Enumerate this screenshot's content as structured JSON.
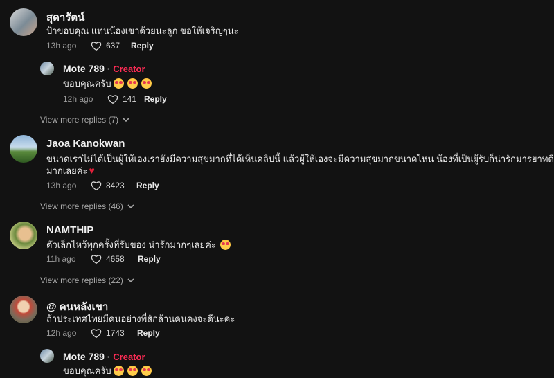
{
  "comments": [
    {
      "username": "สุดารัตน์",
      "text": "ป้าขอบคุณ แทนน้องเขาด้วยนะลูก ขอให้เจริญๆนะ",
      "time": "13h ago",
      "likes": "637",
      "reply_label": "Reply",
      "reply": {
        "username": "Mote 789",
        "separator": "·",
        "badge": "Creator",
        "text": "ขอบคุณครับ",
        "emojis": [
          "smiling-face-with-hearts",
          "smiling-face-with-hearts",
          "smiling-face-with-hearts"
        ],
        "time": "12h ago",
        "likes": "141",
        "reply_label": "Reply"
      },
      "view_more": "View more replies (7)"
    },
    {
      "username": "Jaoa Kanokwan",
      "text_line1": "ขนาดเราไม่ได้เป็นผู้ให้เองเรายังมีความสุขมากที่ได้เห็นคลิปนี้ แล้วผู้ให้เองจะมีความสุขมากขนาดไหน น้องที่เป็นผู้รับก็น่ารักมารยาทดี",
      "text_line2": "มากเลยค่ะ",
      "emoji": "red-heart",
      "time": "13h ago",
      "likes": "8423",
      "reply_label": "Reply",
      "view_more": "View more replies (46)"
    },
    {
      "username": "NAMTHIP",
      "text": "ตัวเล็กไหว้ทุกครั้งที่รับของ น่ารักมากๆเลยค่ะ",
      "emoji": "smiling-face-with-hearts",
      "time": "11h ago",
      "likes": "4658",
      "reply_label": "Reply",
      "view_more": "View more replies (22)"
    },
    {
      "username": "@ คนหลังเขา",
      "text": "ถ้าประเทศไทยมีคนอย่างพี่สักล้านคนคงจะดีนะคะ",
      "time": "12h ago",
      "likes": "1743",
      "reply_label": "Reply",
      "reply": {
        "username": "Mote 789",
        "separator": "·",
        "badge": "Creator",
        "text": "ขอบคุณครับ",
        "emojis": [
          "smiling-face-with-hearts",
          "smiling-face-with-hearts",
          "smiling-face-with-hearts"
        ]
      }
    }
  ],
  "heart_glyph": "♥"
}
